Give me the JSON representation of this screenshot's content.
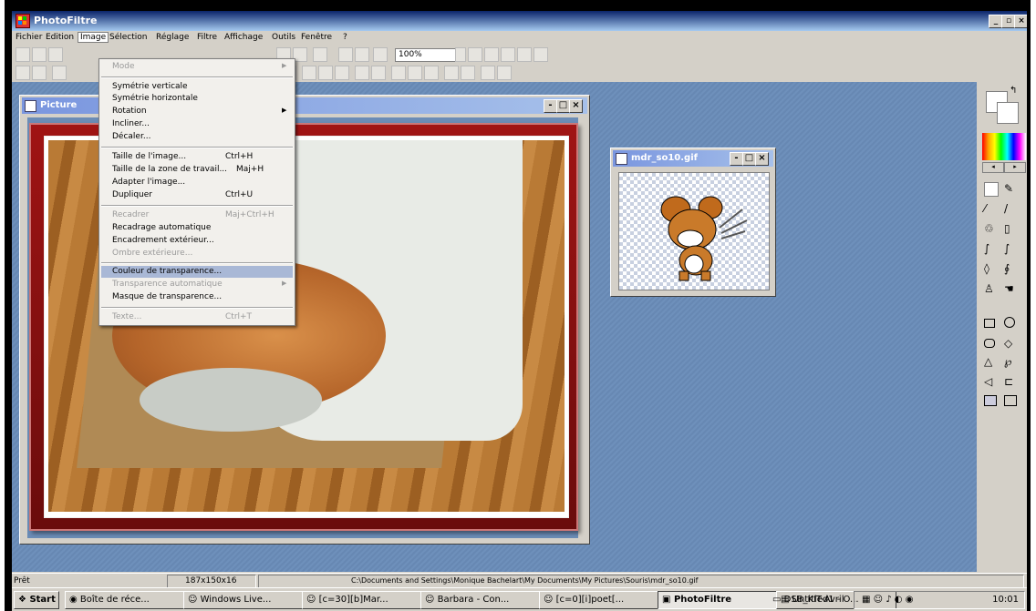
{
  "app": {
    "title": "PhotoFiltre"
  },
  "menubar": [
    "Fichier",
    "Edition",
    "Image",
    "Sélection",
    "Réglage",
    "Filtre",
    "Affichage",
    "Outils",
    "Fenêtre",
    "?"
  ],
  "toolbar": {
    "zoom": "100%"
  },
  "image_menu": {
    "mode": "Mode",
    "sym_v": "Symétrie verticale",
    "sym_h": "Symétrie horizontale",
    "rotation": "Rotation",
    "incliner": "Incliner...",
    "decaler": "Décaler...",
    "taille_image": "Taille de l'image...",
    "taille_image_sc": "Ctrl+H",
    "taille_zone": "Taille de la zone de travail...",
    "taille_zone_sc": "Maj+H",
    "adapter": "Adapter l'image...",
    "dupliquer": "Dupliquer",
    "dupliquer_sc": "Ctrl+U",
    "recadrer": "Recadrer",
    "recadrer_sc": "Maj+Ctrl+H",
    "recadrage_auto": "Recadrage automatique",
    "encadrement": "Encadrement extérieur...",
    "ombre": "Ombre extérieure...",
    "couleur_transp": "Couleur de transparence...",
    "transp_auto": "Transparence automatique",
    "masque": "Masque de transparence...",
    "texte": "Texte...",
    "texte_sc": "Ctrl+T"
  },
  "doc1": {
    "title": "Picture"
  },
  "doc2": {
    "title": "mdr_so10.gif"
  },
  "status": {
    "state": "Prêt",
    "size": "187x150x16",
    "path": "C:\\Documents and Settings\\Monique Bachelart\\My Documents\\My Pictures\\Souris\\mdr_so10.gif"
  },
  "taskbar": {
    "start": "Start",
    "tasks": [
      "Boîte de réce...",
      "Windows Live...",
      "[c=30][b]Mar...",
      "Barbara - Con...",
      "[c=0][i]poet[...",
      "PhotoFiltre",
      "Untitled1 - O...",
      "DSB_KIT-Avril"
    ],
    "clock": "10:01"
  },
  "colors": {
    "accent": "#0a246a",
    "workspace": "#6b8cb6",
    "frame": "#8b1a1a"
  }
}
